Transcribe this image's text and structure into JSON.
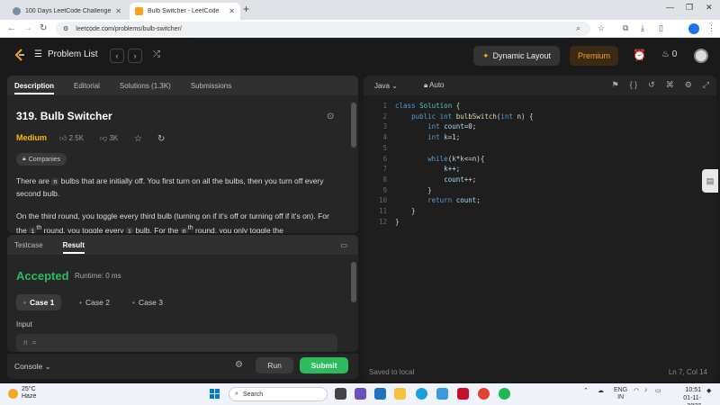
{
  "browser": {
    "tabs": [
      {
        "title": "100 Days LeetCode Challenge",
        "active": false
      },
      {
        "title": "Bulb Switcher - LeetCode",
        "active": true
      }
    ],
    "url": "leetcode.com/problems/bulb-switcher/"
  },
  "nav": {
    "problem_list": "Problem List",
    "dynamic_layout": "Dynamic Layout",
    "premium": "Premium",
    "streak": "0"
  },
  "description_panel": {
    "tabs": [
      "Description",
      "Editorial",
      "Solutions (1.3K)",
      "Submissions"
    ],
    "title": "319. Bulb Switcher",
    "difficulty": "Medium",
    "likes": "2.5K",
    "dislikes": "3K",
    "companies": "Companies",
    "para1": {
      "before": "There are ",
      "code": "n",
      "after": " bulbs that are initially off. You first turn on all the bulbs, then you turn off every second bulb."
    },
    "para2": {
      "p1": "On the third round, you toggle every third bulb (turning on if it's off or turning off if it's on). For the ",
      "c1": "i",
      "s1": "th",
      "p2": " round, you toggle every ",
      "c2": "i",
      "p3": " bulb. For the ",
      "c3": "n",
      "s3": "th",
      "p4": " round, you only toggle the"
    }
  },
  "test_panel": {
    "tabs": [
      "Testcase",
      "Result"
    ],
    "status": "Accepted",
    "runtime": "Runtime: 0 ms",
    "cases": [
      "Case 1",
      "Case 2",
      "Case 3"
    ],
    "input_label": "Input",
    "input_value": "n ="
  },
  "bottom": {
    "console": "Console",
    "run": "Run",
    "submit": "Submit"
  },
  "editor": {
    "language": "Java",
    "auto": "Auto",
    "code_lines": [
      "class Solution {",
      "    public int bulbSwitch(int n) {",
      "        int count=0;",
      "        int k=1;",
      "",
      "        while(k*k<=n){",
      "            k++;",
      "            count++;",
      "        }",
      "        return count;",
      "    }",
      "}"
    ],
    "saved": "Saved to local",
    "position": "Ln 7, Col 14"
  },
  "taskbar": {
    "temp": "25°C",
    "weather": "Haze",
    "search": "Search",
    "lang1": "ENG",
    "lang2": "IN",
    "time": "10:51",
    "date": "01-11-2023"
  },
  "colors": {
    "accepted": "#2cbb5d",
    "medium": "#ffb800",
    "premium": "#ffa116"
  }
}
